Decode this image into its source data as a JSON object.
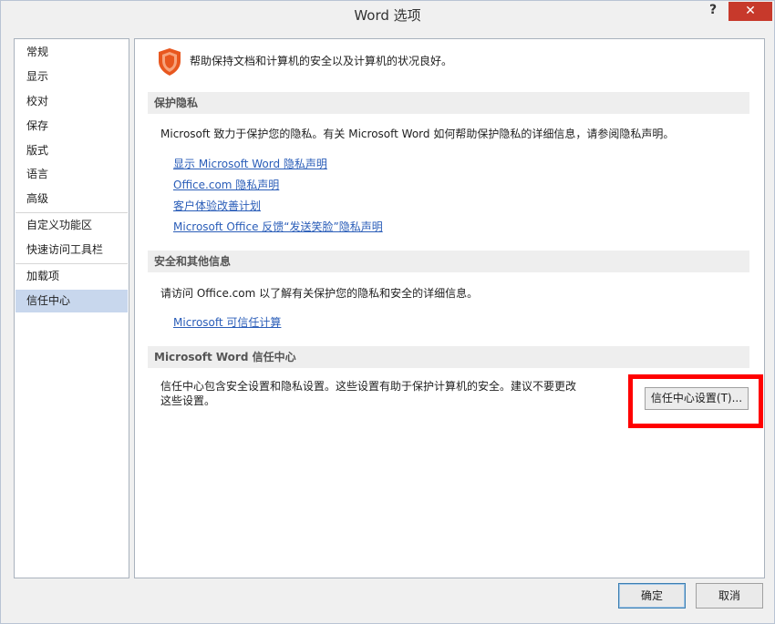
{
  "window": {
    "title": "Word 选项",
    "help": "?",
    "close": "✕"
  },
  "nav": {
    "items": [
      "常规",
      "显示",
      "校对",
      "保存",
      "版式",
      "语言",
      "高级",
      "自定义功能区",
      "快速访问工具栏",
      "加载项",
      "信任中心"
    ],
    "selected": "信任中心"
  },
  "content": {
    "top_text": "帮助保持文档和计算机的安全以及计算机的状况良好。",
    "privacy": {
      "header": "保护隐私",
      "text": "Microsoft 致力于保护您的隐私。有关 Microsoft Word 如何帮助保护隐私的详细信息，请参阅隐私声明。",
      "links": [
        "显示 Microsoft Word 隐私声明",
        "Office.com 隐私声明",
        "客户体验改善计划",
        "Microsoft Office 反馈“发送笑脸”隐私声明"
      ]
    },
    "security": {
      "header": "安全和其他信息",
      "text": "请访问 Office.com  以了解有关保护您的隐私和安全的详细信息。",
      "link": "Microsoft 可信任计算"
    },
    "trust_center": {
      "header": "Microsoft Word 信任中心",
      "text_line1": "信任中心包含安全设置和隐私设置。这些设置有助于保护计算机的安全。建议不要更改",
      "text_line2": "这些设置。",
      "button": "信任中心设置(T)..."
    }
  },
  "footer": {
    "ok": "确定",
    "cancel": "取消"
  },
  "icons": {
    "shield": "shield-icon",
    "shield_color": "#e8571f"
  },
  "colors": {
    "link": "#2a5db8",
    "selected_nav": "#c8d7ed",
    "highlight": "#ff0000",
    "close_bg": "#c7392b"
  }
}
